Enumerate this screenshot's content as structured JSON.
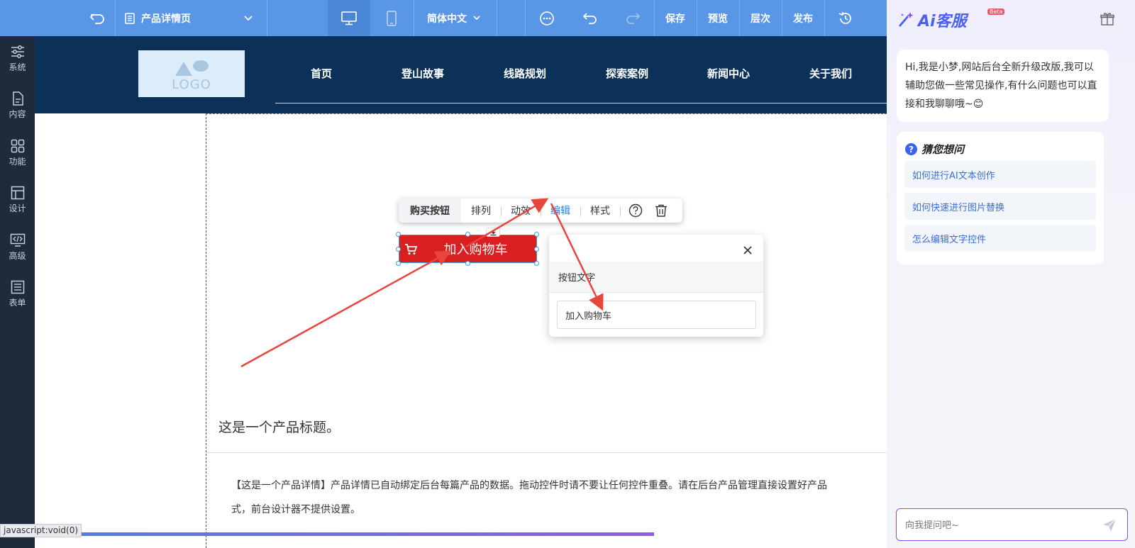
{
  "toolbar": {
    "page_label": "产品详情页",
    "language": "简体中文",
    "save": "保存",
    "preview": "预览",
    "layers": "层次",
    "publish": "发布"
  },
  "sidebar": {
    "items": [
      {
        "label": "系统",
        "icon": "sliders-icon"
      },
      {
        "label": "内容",
        "icon": "document-icon"
      },
      {
        "label": "功能",
        "icon": "grid-icon"
      },
      {
        "label": "设计",
        "icon": "layout-icon"
      },
      {
        "label": "高级",
        "icon": "code-icon"
      },
      {
        "label": "表单",
        "icon": "list-icon"
      }
    ]
  },
  "site": {
    "logo_text": "LOGO",
    "nav": [
      "首页",
      "登山故事",
      "线路规划",
      "探索案例",
      "新闻中心",
      "关于我们"
    ]
  },
  "float_toolbar": {
    "items": [
      "购买按钮",
      "排列",
      "动效",
      "编辑",
      "样式"
    ]
  },
  "cart_button": {
    "label": "加入购物车"
  },
  "edit_popup": {
    "section_label": "按钮文字",
    "value": "加入购物车"
  },
  "product": {
    "title": "这是一个产品标题。",
    "desc_line1": "【这是一个产品详情】产品详情已自动绑定后台每篇产品的数据。拖动控件时请不要让任何控件重叠。请在后台产品管理直接设置好产品",
    "desc_line2": "式，前台设计器不提供设置。"
  },
  "status_bar": "javascript:void(0)",
  "ai": {
    "title": "Ai客服",
    "badge": "Beta",
    "greeting": "Hi,我是小梦,网站后台全新升级改版,我可以辅助您做一些常见操作,有什么问题也可以直接和我聊聊哦~😊",
    "guess_title": "猜您想问",
    "questions": [
      "如何进行AI文本创作",
      "如何快速进行图片替换",
      "怎么编辑文字控件"
    ],
    "input_placeholder": "向我提问吧~"
  },
  "colors": {
    "toolbar_bg": "#5a96e6",
    "sidebar_bg": "#1f2a3a",
    "site_header_bg": "#0c3158",
    "cart_button_bg": "#d91f1f",
    "annotation_arrow": "#e8453c",
    "ai_accent": "#4b5ff0"
  }
}
